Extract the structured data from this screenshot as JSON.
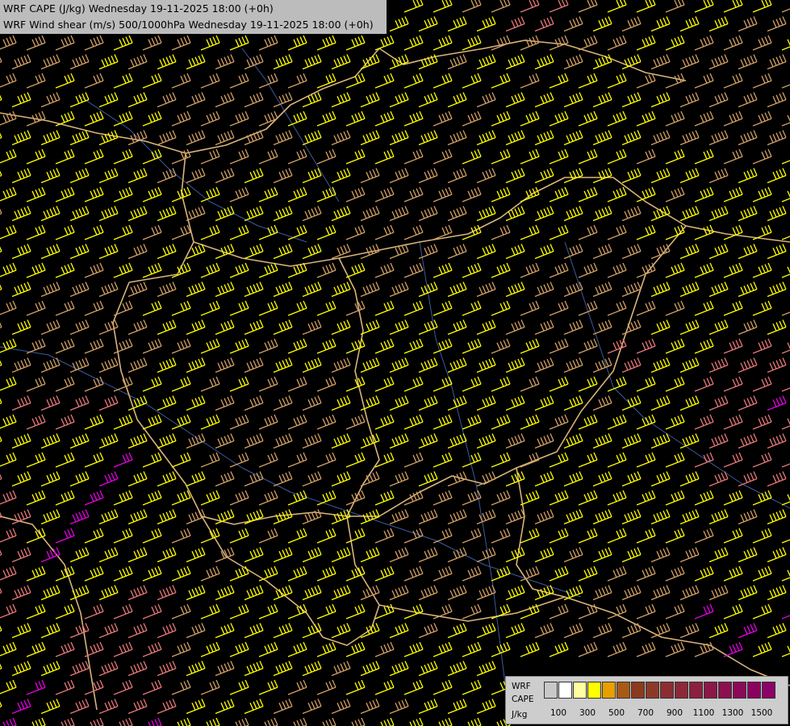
{
  "header": {
    "title_cape": "WRF CAPE (J/kg) Wednesday 19-11-2025 18:00 (+0h)",
    "title_shear": "WRF Wind shear (m/s) 500/1000hPa Wednesday 19-11-2025 18:00 (+0h)"
  },
  "legend": {
    "model": "WRF",
    "variable": "CAPE",
    "unit": "J/kg",
    "colors": [
      "#c8c8c8",
      "#ffffff",
      "#ffffa0",
      "#ffff00",
      "#e8a000",
      "#a85a14",
      "#8c3a1e",
      "#8c3a28",
      "#8c2d32",
      "#8c2838",
      "#8c2040",
      "#8c1848",
      "#8c1050",
      "#8c0858",
      "#8c0060",
      "#8c0068"
    ],
    "tick_labels": [
      "100",
      "300",
      "500",
      "700",
      "900",
      "1100",
      "1300",
      "1500"
    ]
  },
  "map": {
    "barb_colors": {
      "low": "#ffff00",
      "mid": "#d2a064",
      "high": "#e87878",
      "extreme": "#e600e6"
    },
    "border_color": "#d9b47a",
    "river_color": "#3d5a9e"
  }
}
